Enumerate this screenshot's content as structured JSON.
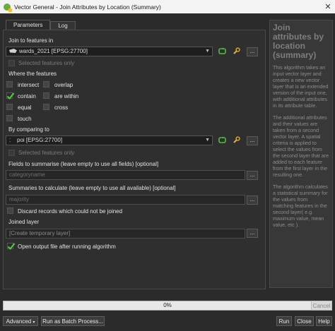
{
  "window": {
    "title": "Vector General - Join Attributes by Location (Summary)",
    "close_symbol": "✕"
  },
  "tabs": [
    {
      "label": "Parameters"
    },
    {
      "label": "Log"
    }
  ],
  "params": {
    "join_label": "Join to features in",
    "join_layer": "wards_2021 [EPSG:27700]",
    "join_selected_only": "Selected features only",
    "where_label": "Where the features",
    "predicates": [
      {
        "label": "intersect",
        "checked": false
      },
      {
        "label": "overlap",
        "checked": false
      },
      {
        "label": "contain",
        "checked": true
      },
      {
        "label": "are within",
        "checked": false
      },
      {
        "label": "equal",
        "checked": false
      },
      {
        "label": "cross",
        "checked": false
      },
      {
        "label": "touch",
        "checked": false
      }
    ],
    "compare_label": "By comparing to",
    "compare_layer": "poi [EPSG:27700]",
    "compare_selected_only": "Selected features only",
    "fields_label": "Fields to summarise (leave empty to use all fields) [optional]",
    "fields_placeholder": "categoryname",
    "summaries_label": "Summaries to calculate (leave empty to use all available) [optional]",
    "summaries_placeholder": "majority",
    "discard_label": "Discard records which could not be joined",
    "discard_checked": false,
    "joined_label": "Joined layer",
    "joined_placeholder": "[Create temporary layer]",
    "open_output_label": "Open output file after running algorithm",
    "open_output_checked": true,
    "dots": "..."
  },
  "help": {
    "title": "Join attributes by location (summary)",
    "paragraphs": [
      "This algorithm takes an input vector layer and creates a new vector layer that is an extended version of the input one, with additional attributes in its attribute table.",
      "The additional attributes and their values are taken from a second vector layer. A spatial criteria is applied to select the values from the second layer that are added to each feature from the first layer in the resulting one.",
      "The algorithm calculates a statistical summary for the values from matching features in the second layer( e.g. maximum value, mean value, etc )."
    ]
  },
  "progress": {
    "text": "0%",
    "value": 0,
    "cancel_label": "Cancel"
  },
  "footer": {
    "advanced_label": "Advanced",
    "batch_label": "Run as Batch Process...",
    "run_label": "Run",
    "close_label": "Close",
    "help_label": "Help"
  },
  "colors": {
    "check": "#4cd137",
    "progress": "#4caf50",
    "iterate_icon": "#56b847",
    "wrench_icon": "#e0b040"
  }
}
